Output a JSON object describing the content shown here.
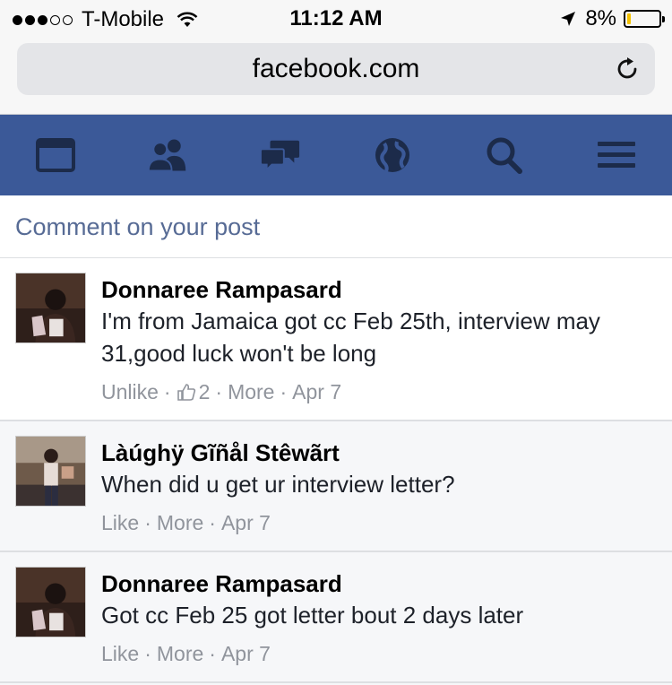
{
  "status_bar": {
    "carrier": "T-Mobile",
    "time": "11:12 AM",
    "battery": "8%"
  },
  "browser": {
    "url": "facebook.com"
  },
  "nav": {
    "items": [
      "news-feed-icon",
      "friend-requests-icon",
      "messages-icon",
      "notifications-globe-icon",
      "search-icon",
      "menu-icon"
    ]
  },
  "header": {
    "title": "Comment on your post"
  },
  "comments": [
    {
      "author": "Donnaree Rampasard",
      "text": "I'm from Jamaica got cc Feb 25th, interview may 31,good luck won't be long",
      "action": "Unlike",
      "likes": "2",
      "more": "More",
      "date": "Apr 7"
    },
    {
      "author": "Làúghÿ Gĩñål Stêwãrt",
      "text": "When did u get ur interview letter?",
      "action": "Like",
      "more": "More",
      "date": "Apr 7"
    },
    {
      "author": "Donnaree Rampasard",
      "text": "Got cc Feb 25 got letter bout 2 days later",
      "action": "Like",
      "more": "More",
      "date": "Apr 7"
    }
  ],
  "colors": {
    "nav_bg": "#3b5998",
    "meta_gray": "#90949c",
    "header_link": "#576b95"
  }
}
